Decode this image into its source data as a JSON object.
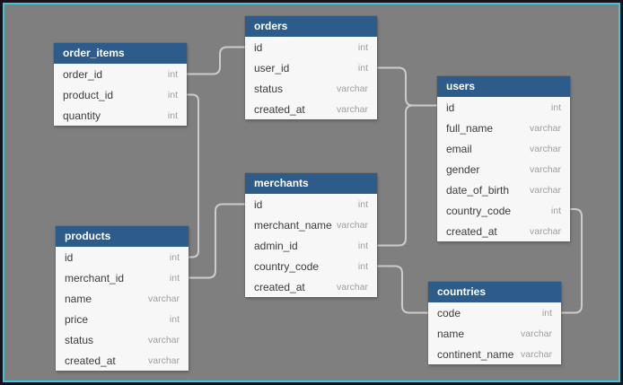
{
  "diagram": {
    "kind": "entity-relationship-diagram",
    "colors": {
      "canvas_bg": "#7f7f7f",
      "frame_border": "#14141e",
      "frame_accent": "#46c4d4",
      "table_header_bg": "#2d5c8a",
      "table_header_text": "#ffffff",
      "table_body_bg": "#f7f7f7",
      "field_name_text": "#3b3b3b",
      "field_type_text": "#9e9e9e",
      "relationship_line": "#cccccc"
    },
    "tables": [
      {
        "name": "order_items",
        "fields": [
          {
            "name": "order_id",
            "type": "int"
          },
          {
            "name": "product_id",
            "type": "int"
          },
          {
            "name": "quantity",
            "type": "int"
          }
        ]
      },
      {
        "name": "orders",
        "fields": [
          {
            "name": "id",
            "type": "int"
          },
          {
            "name": "user_id",
            "type": "int"
          },
          {
            "name": "status",
            "type": "varchar"
          },
          {
            "name": "created_at",
            "type": "varchar"
          }
        ]
      },
      {
        "name": "products",
        "fields": [
          {
            "name": "id",
            "type": "int"
          },
          {
            "name": "merchant_id",
            "type": "int"
          },
          {
            "name": "name",
            "type": "varchar"
          },
          {
            "name": "price",
            "type": "int"
          },
          {
            "name": "status",
            "type": "varchar"
          },
          {
            "name": "created_at",
            "type": "varchar"
          }
        ]
      },
      {
        "name": "merchants",
        "fields": [
          {
            "name": "id",
            "type": "int"
          },
          {
            "name": "merchant_name",
            "type": "varchar"
          },
          {
            "name": "admin_id",
            "type": "int"
          },
          {
            "name": "country_code",
            "type": "int"
          },
          {
            "name": "created_at",
            "type": "varchar"
          }
        ]
      },
      {
        "name": "users",
        "fields": [
          {
            "name": "id",
            "type": "int"
          },
          {
            "name": "full_name",
            "type": "varchar"
          },
          {
            "name": "email",
            "type": "varchar"
          },
          {
            "name": "gender",
            "type": "varchar"
          },
          {
            "name": "date_of_birth",
            "type": "varchar"
          },
          {
            "name": "country_code",
            "type": "int"
          },
          {
            "name": "created_at",
            "type": "varchar"
          }
        ]
      },
      {
        "name": "countries",
        "fields": [
          {
            "name": "code",
            "type": "int"
          },
          {
            "name": "name",
            "type": "varchar"
          },
          {
            "name": "continent_name",
            "type": "varchar"
          }
        ]
      }
    ],
    "relationships": [
      {
        "from": "order_items.order_id",
        "to": "orders.id"
      },
      {
        "from": "order_items.product_id",
        "to": "products.id"
      },
      {
        "from": "merchants.id",
        "to": "products.merchant_id"
      },
      {
        "from": "orders.user_id",
        "to": "users.id"
      },
      {
        "from": "merchants.admin_id",
        "to": "users.id"
      },
      {
        "from": "merchants.country_code",
        "to": "countries.code"
      },
      {
        "from": "users.country_code",
        "to": "countries.code"
      }
    ]
  }
}
